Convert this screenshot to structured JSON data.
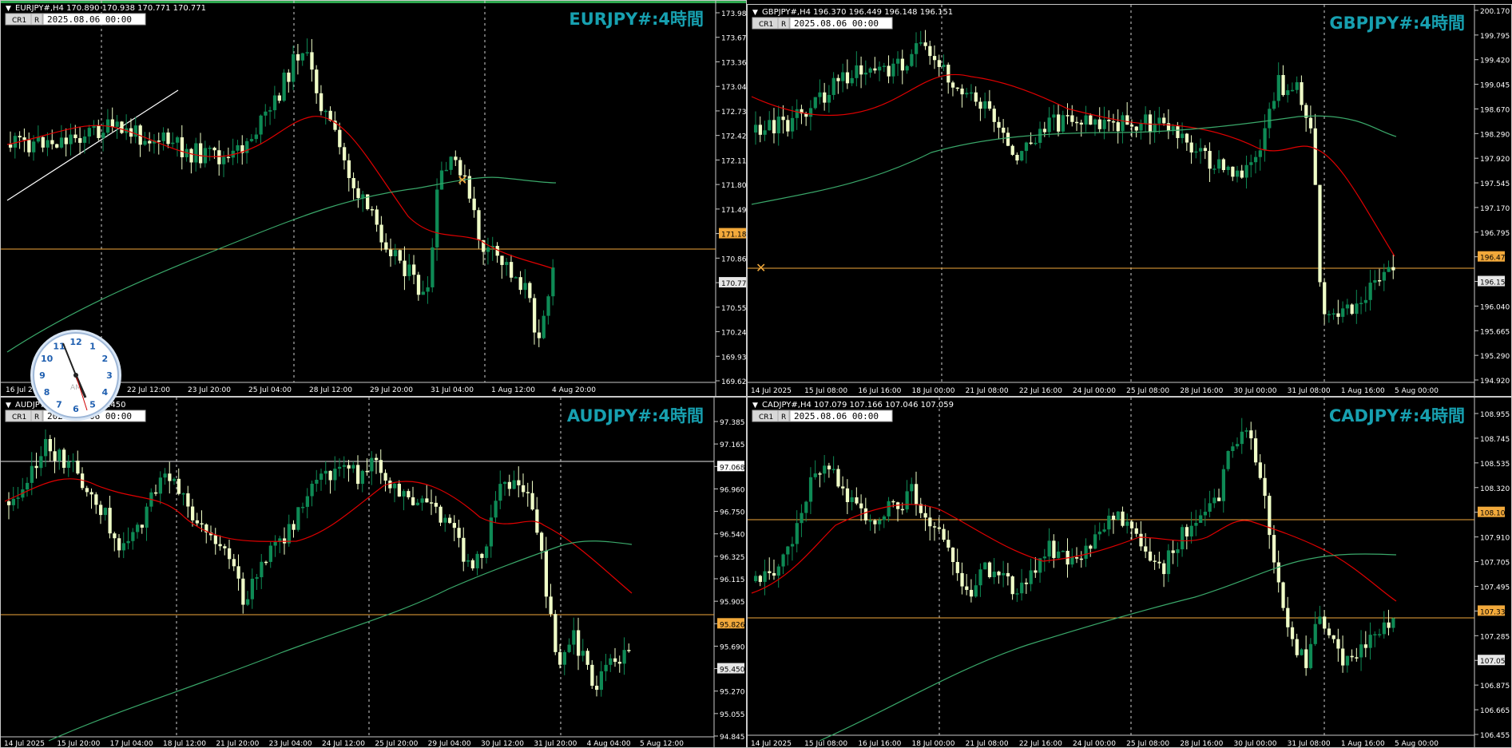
{
  "colors": {
    "background": "#000000",
    "bull_candle": "#0e8a55",
    "bear_candle": "#f0ffc8",
    "ma_fast": "#e00000",
    "ma_slow": "#3aa86a",
    "horizontal_line": "#f2a93b",
    "grid_dashed": "#c8c8c8",
    "title": "#17a0b0",
    "axis_text": "#ffffff"
  },
  "panels": [
    {
      "id": "eurjpy",
      "header": "EURJPY#,H4  170.890 170.938 170.771 170.771",
      "btn_cr": "CR1",
      "btn_r": "R",
      "date_box": "2025.08.06 00:00",
      "watermark": "EURJPY#:4時間",
      "price_labels": [
        "173.980",
        "173.670",
        "173.360",
        "173.045",
        "172.735",
        "172.425",
        "172.110",
        "171.800",
        "171.490",
        "171.182",
        "170.865",
        "170.771",
        "170.555",
        "170.245",
        "169.935",
        "169.620"
      ],
      "highlight_labels": [
        {
          "text": "171.182",
          "type": "orange"
        },
        {
          "text": "170.771",
          "type": "current"
        }
      ],
      "time_labels": [
        "16 Jul 2025",
        "18 Jul 04:00",
        "22 Jul 12:00",
        "23 Jul 20:00",
        "25 Jul 04:00",
        "28 Jul 12:00",
        "29 Jul 20:00",
        "31 Jul 04:00",
        "1 Aug 12:00",
        "4 Aug 20:00"
      ]
    },
    {
      "id": "gbpjpy",
      "header": "GBPJPY#,H4  196.370 196.449 196.148 196.151",
      "btn_cr": "CR1",
      "btn_r": "R",
      "date_box": "2025.08.06 00:00",
      "watermark": "GBPJPY#:4時間",
      "price_labels": [
        "200.170",
        "199.795",
        "199.420",
        "199.045",
        "198.670",
        "198.290",
        "197.920",
        "197.545",
        "197.170",
        "196.795",
        "196.478",
        "196.151",
        "196.040",
        "195.665",
        "195.290",
        "194.920"
      ],
      "highlight_labels": [
        {
          "text": "196.478",
          "type": "orange"
        },
        {
          "text": "196.151",
          "type": "current"
        }
      ],
      "time_labels": [
        "14 Jul 2025",
        "15 Jul 08:00",
        "16 Jul 16:00",
        "18 Jul 00:00",
        "21 Jul 08:00",
        "22 Jul 16:00",
        "24 Jul 00:00",
        "25 Jul 08:00",
        "28 Jul 16:00",
        "30 Jul 00:00",
        "31 Jul 08:00",
        "1 Aug 16:00",
        "5 Aug 00:00"
      ]
    },
    {
      "id": "audjpy",
      "header": "AUDJPY#,H4  95.450 95.450",
      "btn_cr": "CR1",
      "btn_r": "R",
      "date_box": "2025.08.06 00:00",
      "watermark": "AUDJPY#:4時間",
      "price_labels": [
        "97.385",
        "97.165",
        "97.068",
        "96.960",
        "96.750",
        "96.540",
        "96.325",
        "96.115",
        "95.905",
        "95.826",
        "95.690",
        "95.450",
        "95.270",
        "95.055",
        "94.845"
      ],
      "highlight_labels": [
        {
          "text": "97.068",
          "type": "white"
        },
        {
          "text": "95.826",
          "type": "orange"
        },
        {
          "text": "95.450",
          "type": "current"
        }
      ],
      "time_labels": [
        "14 Jul 2025",
        "15 Jul 20:00",
        "17 Jul 04:00",
        "18 Jul 12:00",
        "21 Jul 20:00",
        "23 Jul 04:00",
        "24 Jul 12:00",
        "25 Jul 20:00",
        "29 Jul 04:00",
        "30 Jul 12:00",
        "31 Jul 20:00",
        "4 Aug 04:00",
        "5 Aug 12:00"
      ]
    },
    {
      "id": "cadjpy",
      "header": "CADJPY#,H4  107.079 107.166 107.046 107.059",
      "btn_cr": "CR1",
      "btn_r": "R",
      "date_box": "2025.08.06 00:00",
      "watermark": "CADJPY#:4時間",
      "price_labels": [
        "108.955",
        "108.745",
        "108.535",
        "108.320",
        "108.107",
        "107.910",
        "107.705",
        "107.495",
        "107.336",
        "107.285",
        "107.059",
        "106.875",
        "106.665",
        "106.455"
      ],
      "highlight_labels": [
        {
          "text": "108.107",
          "type": "orange"
        },
        {
          "text": "107.336",
          "type": "orange"
        },
        {
          "text": "107.059",
          "type": "current"
        }
      ],
      "time_labels": [
        "14 Jul 2025",
        "15 Jul 08:00",
        "16 Jul 16:00",
        "18 Jul 00:00",
        "21 Jul 08:00",
        "22 Jul 16:00",
        "24 Jul 00:00",
        "25 Jul 08:00",
        "28 Jul 16:00",
        "30 Jul 00:00",
        "31 Jul 08:00",
        "1 Aug 16:00",
        "5 Aug 00:00"
      ]
    }
  ],
  "clock": {
    "numerals": [
      "12",
      "1",
      "2",
      "3",
      "4",
      "5",
      "6",
      "7",
      "8",
      "9",
      "10",
      "11"
    ],
    "ampm": "AM"
  }
}
